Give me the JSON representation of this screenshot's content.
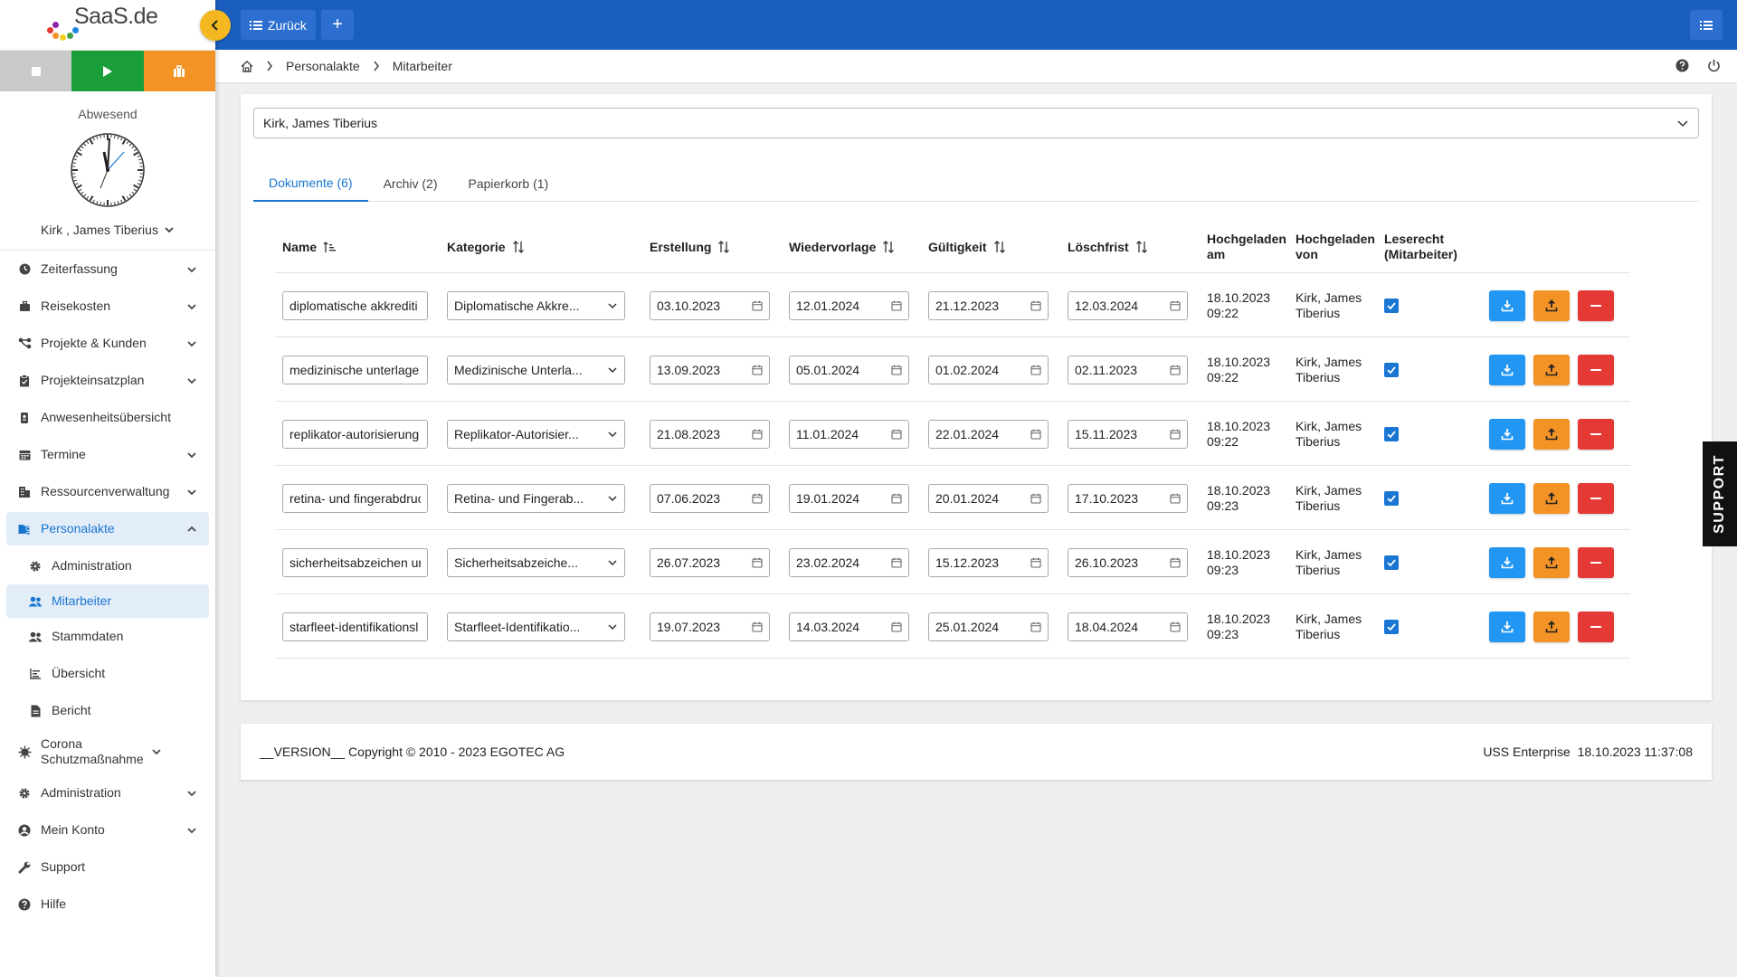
{
  "logo": {
    "text": "SaaS.de"
  },
  "sidebar": {
    "status": "Abwesend",
    "user_name": "Kirk , James Tiberius",
    "menu": [
      {
        "label": "Zeiterfassung",
        "icon": "clock-icon",
        "chevron": "down"
      },
      {
        "label": "Reisekosten",
        "icon": "suitcase-icon",
        "chevron": "down"
      },
      {
        "label": "Projekte & Kunden",
        "icon": "sitemap-icon",
        "chevron": "down"
      },
      {
        "label": "Projekteinsatzplan",
        "icon": "clipboard-icon",
        "chevron": "down"
      },
      {
        "label": "Anwesenheitsübersicht",
        "icon": "badge-icon",
        "chevron": ""
      },
      {
        "label": "Termine",
        "icon": "calendar-icon",
        "chevron": "down"
      },
      {
        "label": "Ressourcenverwaltung",
        "icon": "building-icon",
        "chevron": "down"
      },
      {
        "label": "Personalakte",
        "icon": "folder-user-icon",
        "chevron": "up",
        "active": true
      },
      {
        "label": "Administration",
        "icon": "gear-icon",
        "sub": true
      },
      {
        "label": "Mitarbeiter",
        "icon": "users-icon",
        "sub": true,
        "active": true
      },
      {
        "label": "Stammdaten",
        "icon": "users-icon",
        "sub": true
      },
      {
        "label": "Übersicht",
        "icon": "chart-icon",
        "sub": true
      },
      {
        "label": "Bericht",
        "icon": "file-icon",
        "sub": true
      },
      {
        "label": "Corona Schutzmaßnahme",
        "icon": "virus-icon",
        "chevron": "down"
      },
      {
        "label": "Administration",
        "icon": "gear-icon",
        "chevron": "down"
      },
      {
        "label": "Mein Konto",
        "icon": "user-circle-icon",
        "chevron": "down"
      },
      {
        "label": "Support",
        "icon": "wrench-icon",
        "chevron": ""
      },
      {
        "label": "Hilfe",
        "icon": "question-icon",
        "chevron": ""
      }
    ]
  },
  "topbar": {
    "back_label": "Zurück",
    "add_label": "+"
  },
  "breadcrumb": {
    "items": [
      "Personalakte",
      "Mitarbeiter"
    ]
  },
  "person_select": {
    "value": "Kirk, James Tiberius"
  },
  "tabs": [
    {
      "label": "Dokumente (6)",
      "active": true
    },
    {
      "label": "Archiv (2)"
    },
    {
      "label": "Papierkorb (1)"
    }
  ],
  "table": {
    "headers": {
      "name": "Name",
      "kategorie": "Kategorie",
      "erstellung": "Erstellung",
      "wiedervorlage": "Wiedervorlage",
      "gueltigkeit": "Gültigkeit",
      "loeschfrist": "Löschfrist",
      "hochgeladen_am": "Hochgeladen am",
      "hochgeladen_von": "Hochgeladen von",
      "leserecht": "Leserecht (Mitarbeiter)"
    },
    "rows": [
      {
        "name": "diplomatische akkrediti",
        "kategorie": "Diplomatische Akkre...",
        "erstellung": "03.10.2023",
        "wiedervorlage": "12.01.2024",
        "gueltigkeit": "21.12.2023",
        "loeschfrist": "12.03.2024",
        "hochgeladen_am": [
          "18.10.2023",
          "09:22"
        ],
        "hochgeladen_von": [
          "Kirk, James",
          "Tiberius"
        ],
        "leserecht": true
      },
      {
        "name": "medizinische unterlage",
        "kategorie": "Medizinische Unterla...",
        "erstellung": "13.09.2023",
        "wiedervorlage": "05.01.2024",
        "gueltigkeit": "01.02.2024",
        "loeschfrist": "02.11.2023",
        "hochgeladen_am": [
          "18.10.2023",
          "09:22"
        ],
        "hochgeladen_von": [
          "Kirk, James",
          "Tiberius"
        ],
        "leserecht": true
      },
      {
        "name": "replikator-autorisierung",
        "kategorie": "Replikator-Autorisier...",
        "erstellung": "21.08.2023",
        "wiedervorlage": "11.01.2024",
        "gueltigkeit": "22.01.2024",
        "loeschfrist": "15.11.2023",
        "hochgeladen_am": [
          "18.10.2023",
          "09:22"
        ],
        "hochgeladen_von": [
          "Kirk, James",
          "Tiberius"
        ],
        "leserecht": true
      },
      {
        "name": "retina- und fingerabdruc",
        "kategorie": "Retina- und Fingerab...",
        "erstellung": "07.06.2023",
        "wiedervorlage": "19.01.2024",
        "gueltigkeit": "20.01.2024",
        "loeschfrist": "17.10.2023",
        "hochgeladen_am": [
          "18.10.2023",
          "09:23"
        ],
        "hochgeladen_von": [
          "Kirk, James",
          "Tiberius"
        ],
        "leserecht": true
      },
      {
        "name": "sicherheitsabzeichen ur",
        "kategorie": "Sicherheitsabzeiche...",
        "erstellung": "26.07.2023",
        "wiedervorlage": "23.02.2024",
        "gueltigkeit": "15.12.2023",
        "loeschfrist": "26.10.2023",
        "hochgeladen_am": [
          "18.10.2023",
          "09:23"
        ],
        "hochgeladen_von": [
          "Kirk, James",
          "Tiberius"
        ],
        "leserecht": true
      },
      {
        "name": "starfleet-identifikationsl",
        "kategorie": "Starfleet-Identifikatio...",
        "erstellung": "19.07.2023",
        "wiedervorlage": "14.03.2024",
        "gueltigkeit": "25.01.2024",
        "loeschfrist": "18.04.2024",
        "hochgeladen_am": [
          "18.10.2023",
          "09:23"
        ],
        "hochgeladen_von": [
          "Kirk, James",
          "Tiberius"
        ],
        "leserecht": true
      }
    ]
  },
  "footer": {
    "left": "__VERSION__ Copyright © 2010 - 2023 EGOTEC AG",
    "right": "USS Enterprise  18.10.2023 11:37:08"
  },
  "support_tab": {
    "label": "SUPPORT"
  },
  "colors": {
    "topbar": "#1a5fbf",
    "accent": "#1976d2",
    "green": "#1a9e3a",
    "orange": "#f39325",
    "red": "#e53935",
    "yellow": "#f3b81f"
  }
}
